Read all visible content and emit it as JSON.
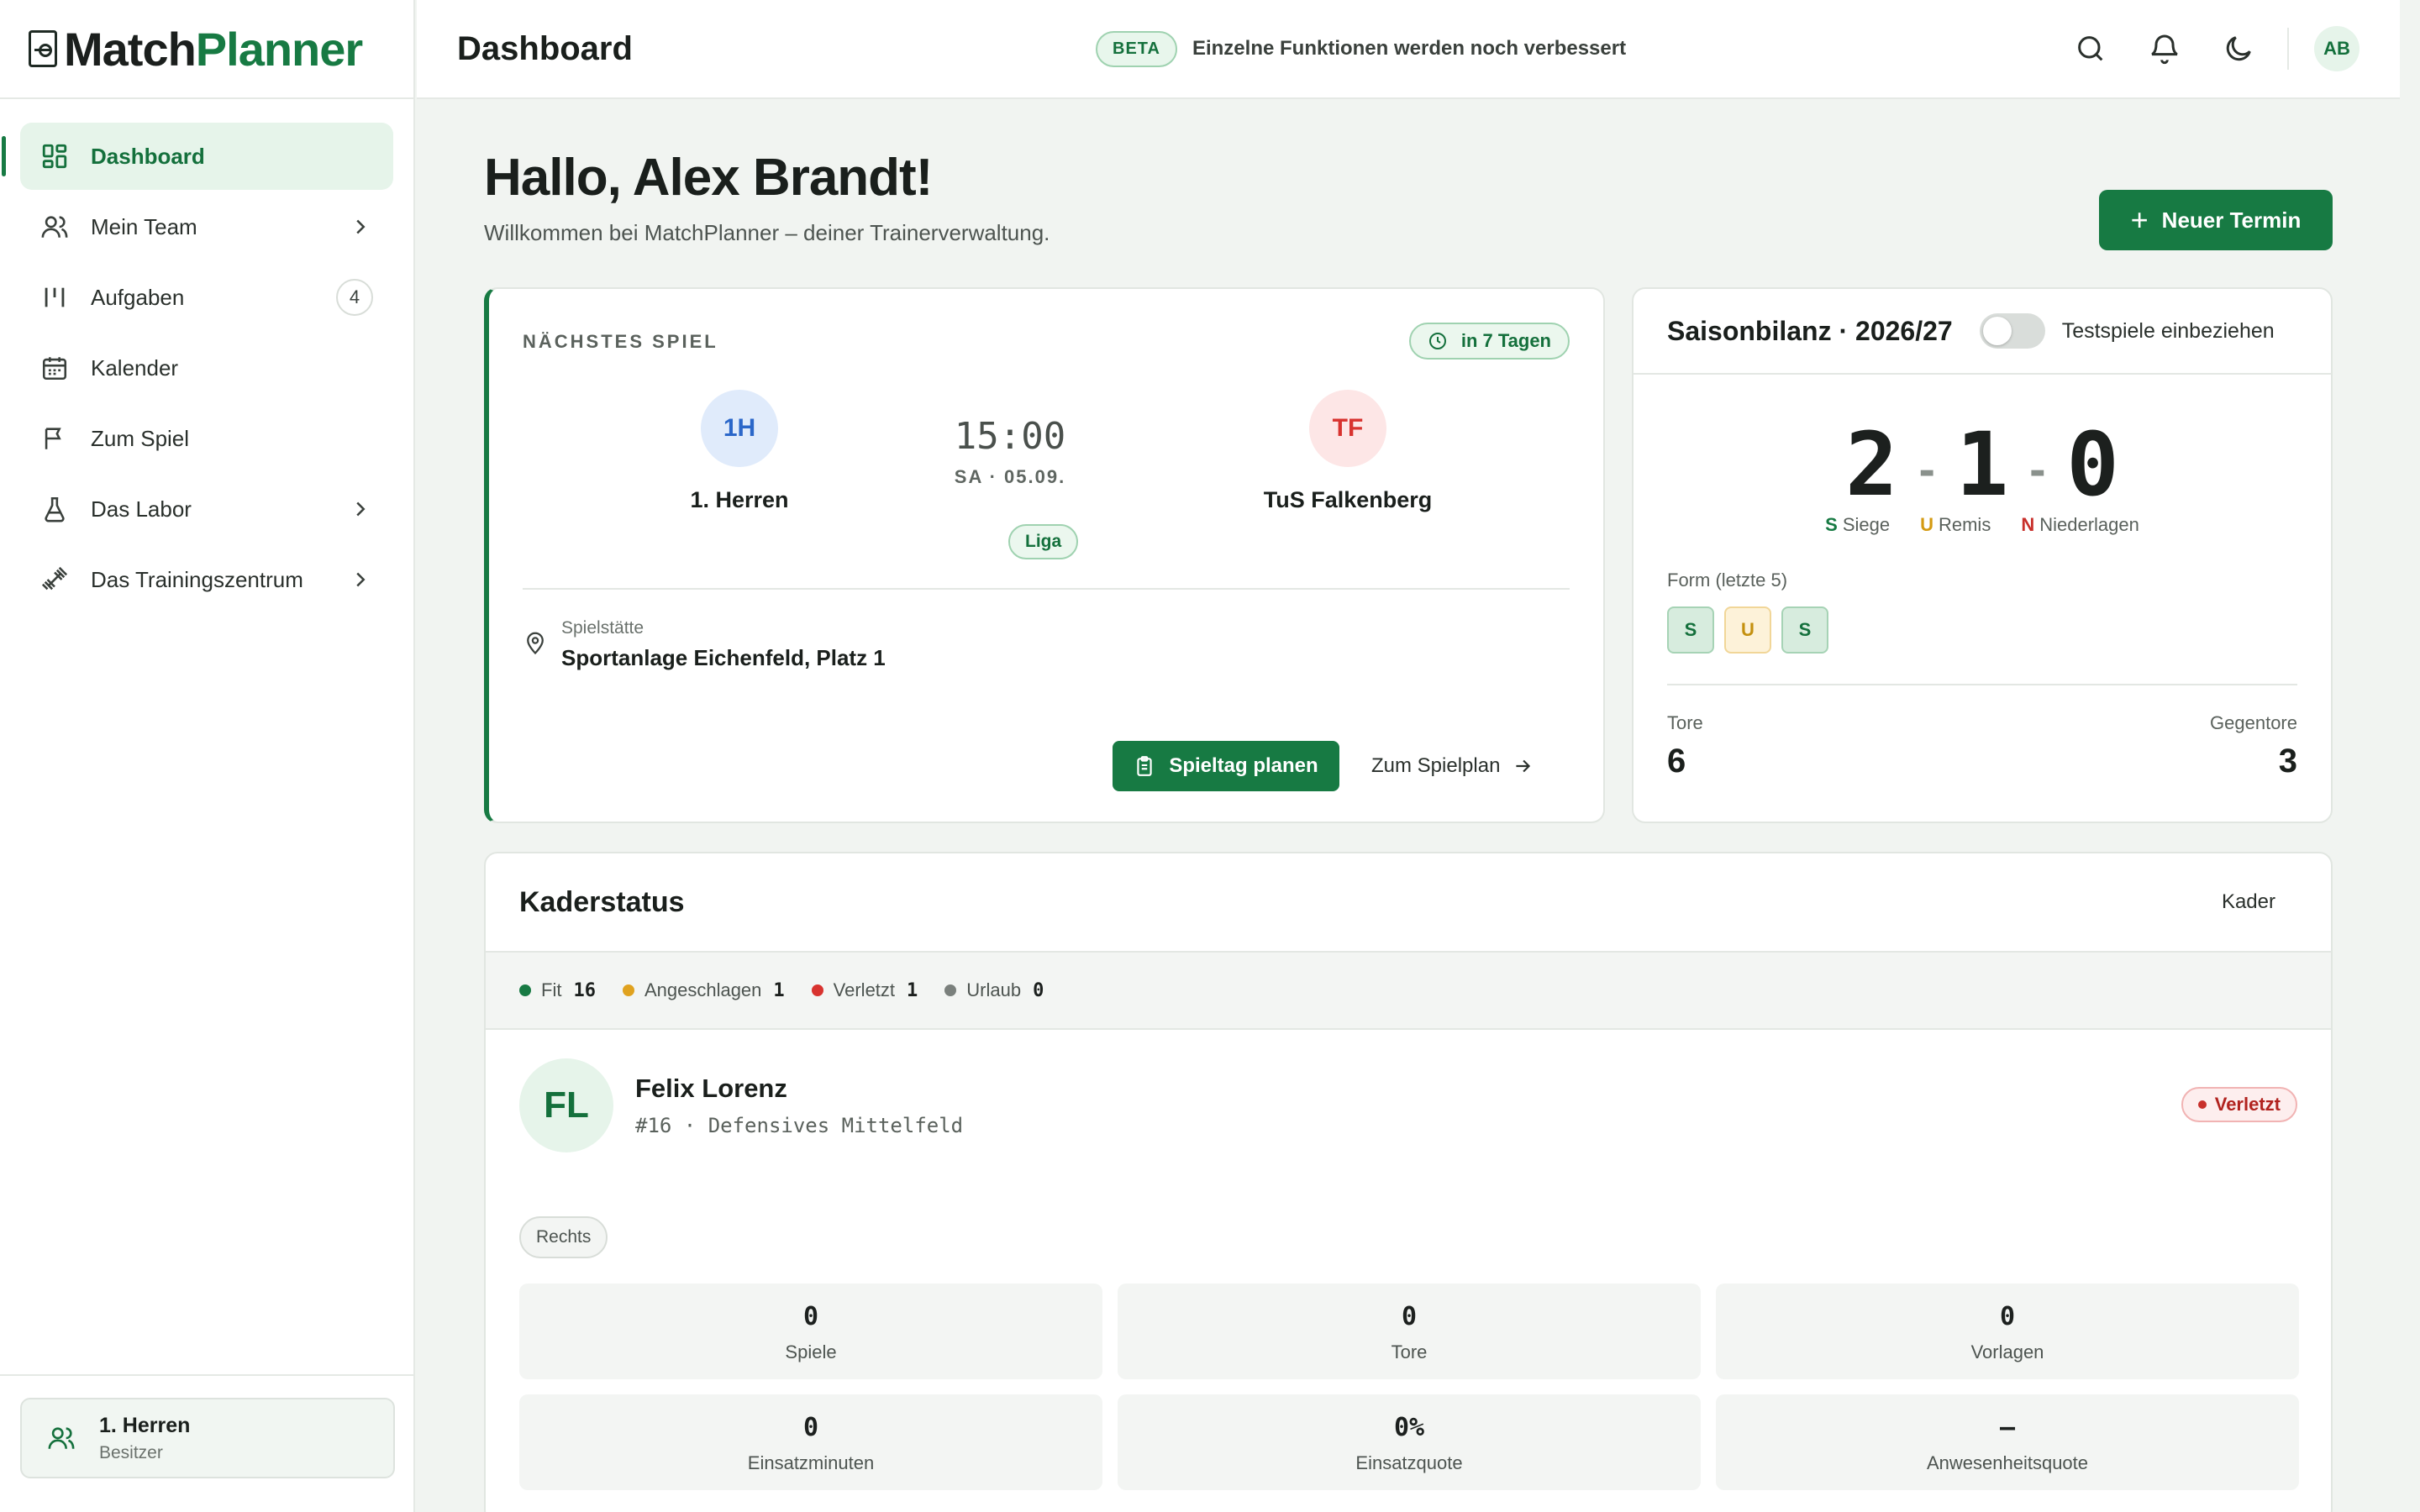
{
  "app": {
    "name_part1": "Match",
    "name_part2": "Planner"
  },
  "header": {
    "title": "Dashboard",
    "beta_badge": "BETA",
    "beta_text": "Einzelne Funktionen werden noch verbessert",
    "avatar_initials": "AB"
  },
  "sidebar": {
    "items": [
      {
        "label": "Dashboard",
        "icon": "dashboard-icon",
        "active": true
      },
      {
        "label": "Mein Team",
        "icon": "users-icon",
        "chevron": true
      },
      {
        "label": "Aufgaben",
        "icon": "tasks-icon",
        "badge": "4"
      },
      {
        "label": "Kalender",
        "icon": "calendar-icon"
      },
      {
        "label": "Zum Spiel",
        "icon": "flag-icon"
      },
      {
        "label": "Das Labor",
        "icon": "flask-icon",
        "chevron": true
      },
      {
        "label": "Das Trainingszentrum",
        "icon": "dumbbell-icon",
        "chevron": true
      }
    ],
    "team": {
      "name": "1. Herren",
      "role": "Besitzer"
    }
  },
  "main": {
    "greeting": "Hallo, Alex Brandt!",
    "welcome": "Willkommen bei MatchPlanner – deiner Trainerverwaltung.",
    "new_button": "Neuer Termin"
  },
  "next_match": {
    "label": "NÄCHSTES SPIEL",
    "countdown": "in 7 Tagen",
    "home": {
      "abbr": "1H",
      "name": "1. Herren"
    },
    "away": {
      "abbr": "TF",
      "name": "TuS Falkenberg"
    },
    "time": "15:00",
    "date": "SA · 05.09.",
    "competition": "Liga",
    "venue_label": "Spielstätte",
    "venue": "Sportanlage Eichenfeld, Platz 1",
    "plan_button": "Spieltag planen",
    "schedule_link": "Zum Spielplan"
  },
  "season": {
    "title": "Saisonbilanz · 2026/27",
    "toggle_label": "Testspiele einbeziehen",
    "toggle_on": false,
    "wins": "2",
    "draws": "1",
    "losses": "0",
    "dash": "-",
    "legend": [
      {
        "key": "S",
        "label": "Siege",
        "color": "#177a43"
      },
      {
        "key": "U",
        "label": "Remis",
        "color": "#d49a12"
      },
      {
        "key": "N",
        "label": "Niederlagen",
        "color": "#c8302b"
      }
    ],
    "form_label": "Form (letzte 5)",
    "form": [
      "S",
      "U",
      "S"
    ],
    "goals_label": "Tore",
    "goals": "6",
    "against_label": "Gegentore",
    "against": "3"
  },
  "squad": {
    "title": "Kaderstatus",
    "link": "Kader",
    "status": [
      {
        "label": "Fit",
        "count": "16",
        "color": "#177a43"
      },
      {
        "label": "Angeschlagen",
        "count": "1",
        "color": "#e0a21f"
      },
      {
        "label": "Verletzt",
        "count": "1",
        "color": "#d8332f"
      },
      {
        "label": "Urlaub",
        "count": "0",
        "color": "#7a807c"
      }
    ],
    "player": {
      "initials": "FL",
      "name": "Felix Lorenz",
      "meta": "#16 · Defensives Mittelfeld",
      "status": "Verletzt",
      "foot": "Rechts",
      "stats": [
        {
          "value": "0",
          "label": "Spiele"
        },
        {
          "value": "0",
          "label": "Tore"
        },
        {
          "value": "0",
          "label": "Vorlagen"
        },
        {
          "value": "0",
          "label": "Einsatzminuten"
        },
        {
          "value": "0%",
          "label": "Einsatzquote"
        },
        {
          "value": "–",
          "label": "Anwesenheitsquote"
        }
      ]
    }
  }
}
